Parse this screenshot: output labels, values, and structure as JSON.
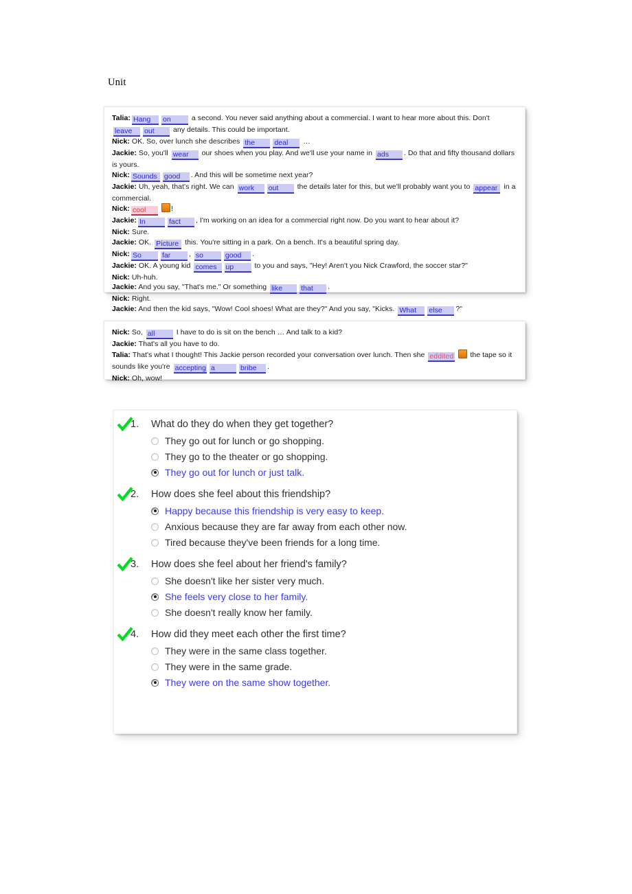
{
  "page": {
    "title": "Unit"
  },
  "dialogue_1": {
    "lines": [
      {
        "speaker": "Talia:",
        "parts": [
          {
            "t": "blank",
            "text": "Hang"
          },
          {
            "t": "blank",
            "text": "on"
          },
          {
            "t": "text",
            "text": " a second. You never said anything about a commercial. I want to hear more about this. Don't "
          },
          {
            "t": "blank",
            "text": "leave"
          },
          {
            "t": "blank",
            "text": "out"
          },
          {
            "t": "text",
            "text": " any details. This could be important."
          }
        ]
      },
      {
        "speaker": "Nick:",
        "parts": [
          {
            "t": "text",
            "text": " OK. So, over lunch she describes "
          },
          {
            "t": "blank",
            "text": "the"
          },
          {
            "t": "blank",
            "text": "deal"
          },
          {
            "t": "text",
            "text": " …"
          }
        ]
      },
      {
        "speaker": "Jackie:",
        "parts": [
          {
            "t": "text",
            "text": " So, you'll "
          },
          {
            "t": "blank",
            "text": "wear"
          },
          {
            "t": "text",
            "text": " our shoes when you play. And we'll use your name in "
          },
          {
            "t": "blank",
            "text": "ads"
          },
          {
            "t": "text",
            "text": ". Do that and fifty thousand dollars is yours."
          }
        ]
      },
      {
        "speaker": "Nick:",
        "parts": [
          {
            "t": "blank",
            "text": "Sounds"
          },
          {
            "t": "blank",
            "text": "good"
          },
          {
            "t": "text",
            "text": ". And this will be sometime next year?"
          }
        ]
      },
      {
        "speaker": "Jackie:",
        "parts": [
          {
            "t": "text",
            "text": " Uh, yeah, that's right. We can "
          },
          {
            "t": "blank",
            "text": "work"
          },
          {
            "t": "blank",
            "text": "out"
          },
          {
            "t": "text",
            "text": " the details later for this, but we'll probably want you to "
          },
          {
            "t": "blank",
            "text": "appear"
          },
          {
            "t": "text",
            "text": " in a commercial."
          }
        ]
      },
      {
        "speaker": "Nick:",
        "parts": [
          {
            "t": "error",
            "text": "cool",
            "button": "■"
          },
          {
            "t": "text",
            "text": "!"
          }
        ]
      },
      {
        "speaker": "Jackie:",
        "parts": [
          {
            "t": "blank",
            "text": "In"
          },
          {
            "t": "blank",
            "text": "fact"
          },
          {
            "t": "text",
            "text": ", I'm working on an idea for a commercial right now. Do you want to hear about it?"
          }
        ]
      },
      {
        "speaker": "Nick:",
        "parts": [
          {
            "t": "text",
            "text": " Sure."
          }
        ]
      },
      {
        "speaker": "Jackie:",
        "parts": [
          {
            "t": "text",
            "text": " OK. "
          },
          {
            "t": "blank",
            "text": "Picture"
          },
          {
            "t": "text",
            "text": " this. You're sitting in a park. On a bench. It's a beautiful spring day."
          }
        ]
      },
      {
        "speaker": "Nick:",
        "parts": [
          {
            "t": "blank",
            "text": "So"
          },
          {
            "t": "blank",
            "text": "far"
          },
          {
            "t": "text",
            "text": ", "
          },
          {
            "t": "blank",
            "text": "so"
          },
          {
            "t": "blank",
            "text": "good"
          },
          {
            "t": "text",
            "text": "."
          }
        ]
      },
      {
        "speaker": "Jackie:",
        "parts": [
          {
            "t": "text",
            "text": " OK. A young kid "
          },
          {
            "t": "blank",
            "text": "comes"
          },
          {
            "t": "blank",
            "text": "up"
          },
          {
            "t": "text",
            "text": " to you and says, \"Hey! Aren't you Nick Crawford, the soccer star?\""
          }
        ]
      },
      {
        "speaker": "Nick:",
        "parts": [
          {
            "t": "text",
            "text": " Uh-huh."
          }
        ]
      },
      {
        "speaker": "Jackie:",
        "parts": [
          {
            "t": "text",
            "text": " And you say, \"That's me.\" Or something "
          },
          {
            "t": "blank",
            "text": "like"
          },
          {
            "t": "blank",
            "text": "that"
          },
          {
            "t": "text",
            "text": "."
          }
        ]
      },
      {
        "speaker": "Nick:",
        "parts": [
          {
            "t": "text",
            "text": " Right."
          }
        ]
      },
      {
        "speaker": "Jackie:",
        "parts": [
          {
            "t": "text",
            "text": " And then the kid says, \"Wow! Cool shoes! What are they?\" And you say, \"Kicks. "
          },
          {
            "t": "blank",
            "text": "What"
          },
          {
            "t": "blank",
            "text": "else"
          },
          {
            "t": "text",
            "text": "?\""
          }
        ]
      }
    ]
  },
  "dialogue_2": {
    "lines": [
      {
        "speaker": "Nick:",
        "parts": [
          {
            "t": "text",
            "text": " So, "
          },
          {
            "t": "blank",
            "text": "all"
          },
          {
            "t": "text",
            "text": " I have to do is sit on the bench … And talk to a kid?"
          }
        ]
      },
      {
        "speaker": "Jackie:",
        "parts": [
          {
            "t": "text",
            "text": " That's all you have to do."
          }
        ]
      },
      {
        "speaker": "Talia:",
        "parts": [
          {
            "t": "text",
            "text": " That's what I thought! This Jackie person recorded your conversation over lunch. Then she "
          },
          {
            "t": "error2",
            "text": "eddited",
            "button": "■"
          },
          {
            "t": "text",
            "text": " the tape so it sounds like you're "
          },
          {
            "t": "blank",
            "text": "accepting"
          },
          {
            "t": "blank",
            "text": "a"
          },
          {
            "t": "blank",
            "text": "bribe"
          },
          {
            "t": "text",
            "text": "."
          }
        ]
      },
      {
        "speaker": "Nick:",
        "parts": [
          {
            "t": "text",
            "text": " Oh, wow!"
          }
        ]
      }
    ]
  },
  "quiz": {
    "questions": [
      {
        "number": "1.",
        "text": "What do they do when they get together?",
        "graded": true,
        "options": [
          {
            "label": "They go out for lunch or go shopping.",
            "selected": false
          },
          {
            "label": "They go to the theater or go shopping.",
            "selected": false
          },
          {
            "label": "They go out for lunch or just talk.",
            "selected": true
          }
        ]
      },
      {
        "number": "2.",
        "text": "How does she feel about this friendship?",
        "graded": true,
        "options": [
          {
            "label": "Happy because this friendship is very easy to keep.",
            "selected": true
          },
          {
            "label": "Anxious because they are far away from each other now.",
            "selected": false
          },
          {
            "label": "Tired because they've been friends for a long time.",
            "selected": false
          }
        ]
      },
      {
        "number": "3.",
        "text": "How does she feel about her friend's family?",
        "graded": true,
        "options": [
          {
            "label": "She doesn't like her sister very much.",
            "selected": false
          },
          {
            "label": "She feels very close to her family.",
            "selected": true
          },
          {
            "label": "She doesn't really know her family.",
            "selected": false
          }
        ]
      },
      {
        "number": "4.",
        "text": "How did they meet each other the first time?",
        "graded": true,
        "options": [
          {
            "label": "They were in the same class together.",
            "selected": false
          },
          {
            "label": "They were in the same grade.",
            "selected": false
          },
          {
            "label": "They were on the same show together.",
            "selected": true
          }
        ]
      }
    ]
  },
  "colors": {
    "blank_text": "#2a2ad6",
    "blank_bg": "#ccccf5",
    "blank_underline": "#3b3bbf",
    "error_text": "#e03a3a",
    "error_bg": "#f6cfd8",
    "smart_tag": "#e1720c",
    "check_green": "#00dd22",
    "selected_answer": "#3b3bf0",
    "teal_bar": "#3f8f99"
  }
}
